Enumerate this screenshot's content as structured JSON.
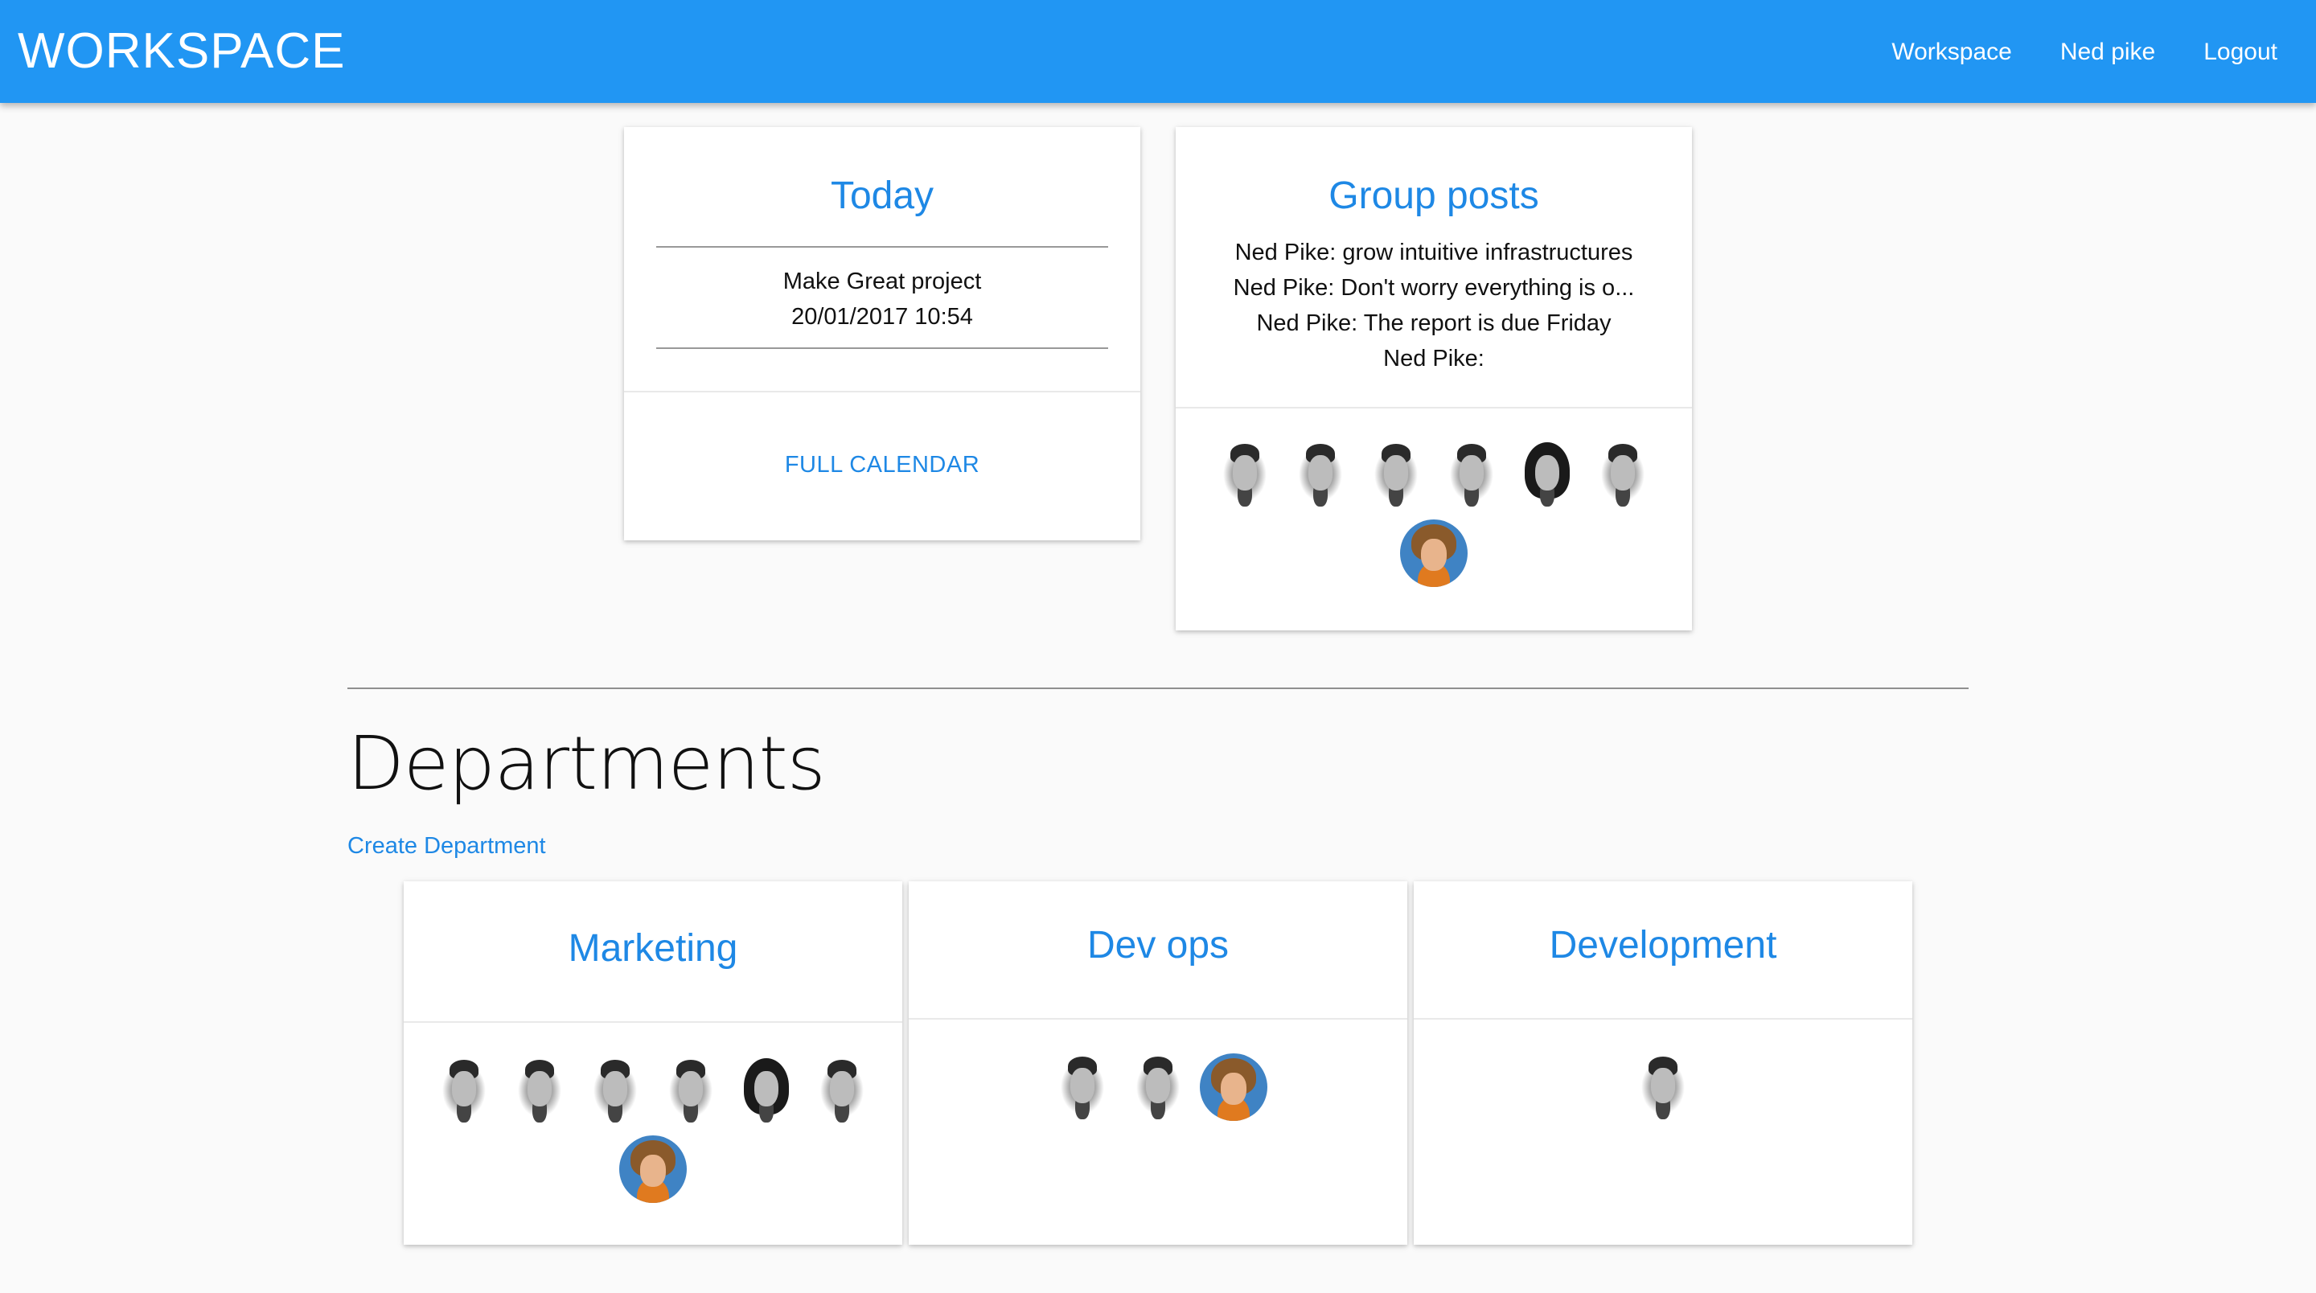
{
  "navbar": {
    "brand": "WORKSPACE",
    "links": [
      "Workspace",
      "Ned pike",
      "Logout"
    ],
    "color": "#2196f3"
  },
  "today": {
    "title": "Today",
    "event": {
      "name": "Make Great project",
      "datetime": "20/01/2017 10:54"
    },
    "action": "FULL CALENDAR"
  },
  "group_posts": {
    "title": "Group posts",
    "posts": [
      "Ned Pike: grow intuitive infrastructures",
      "Ned Pike: Don't worry everything is o...",
      "Ned Pike: The report is due Friday",
      "Ned Pike:"
    ],
    "members": [
      "bw",
      "bw",
      "bw",
      "bw",
      "bw-dark-hair",
      "bw",
      "color"
    ]
  },
  "departments": {
    "title": "Departments",
    "create_label": "Create Department",
    "items": [
      {
        "name": "Marketing",
        "members": [
          "bw",
          "bw",
          "bw",
          "bw",
          "bw-dark-hair",
          "bw",
          "color"
        ]
      },
      {
        "name": "Dev ops",
        "members": [
          "bw",
          "bw",
          "color"
        ]
      },
      {
        "name": "Development",
        "members": [
          "bw"
        ]
      }
    ]
  },
  "accent_color": "#1e88e5"
}
